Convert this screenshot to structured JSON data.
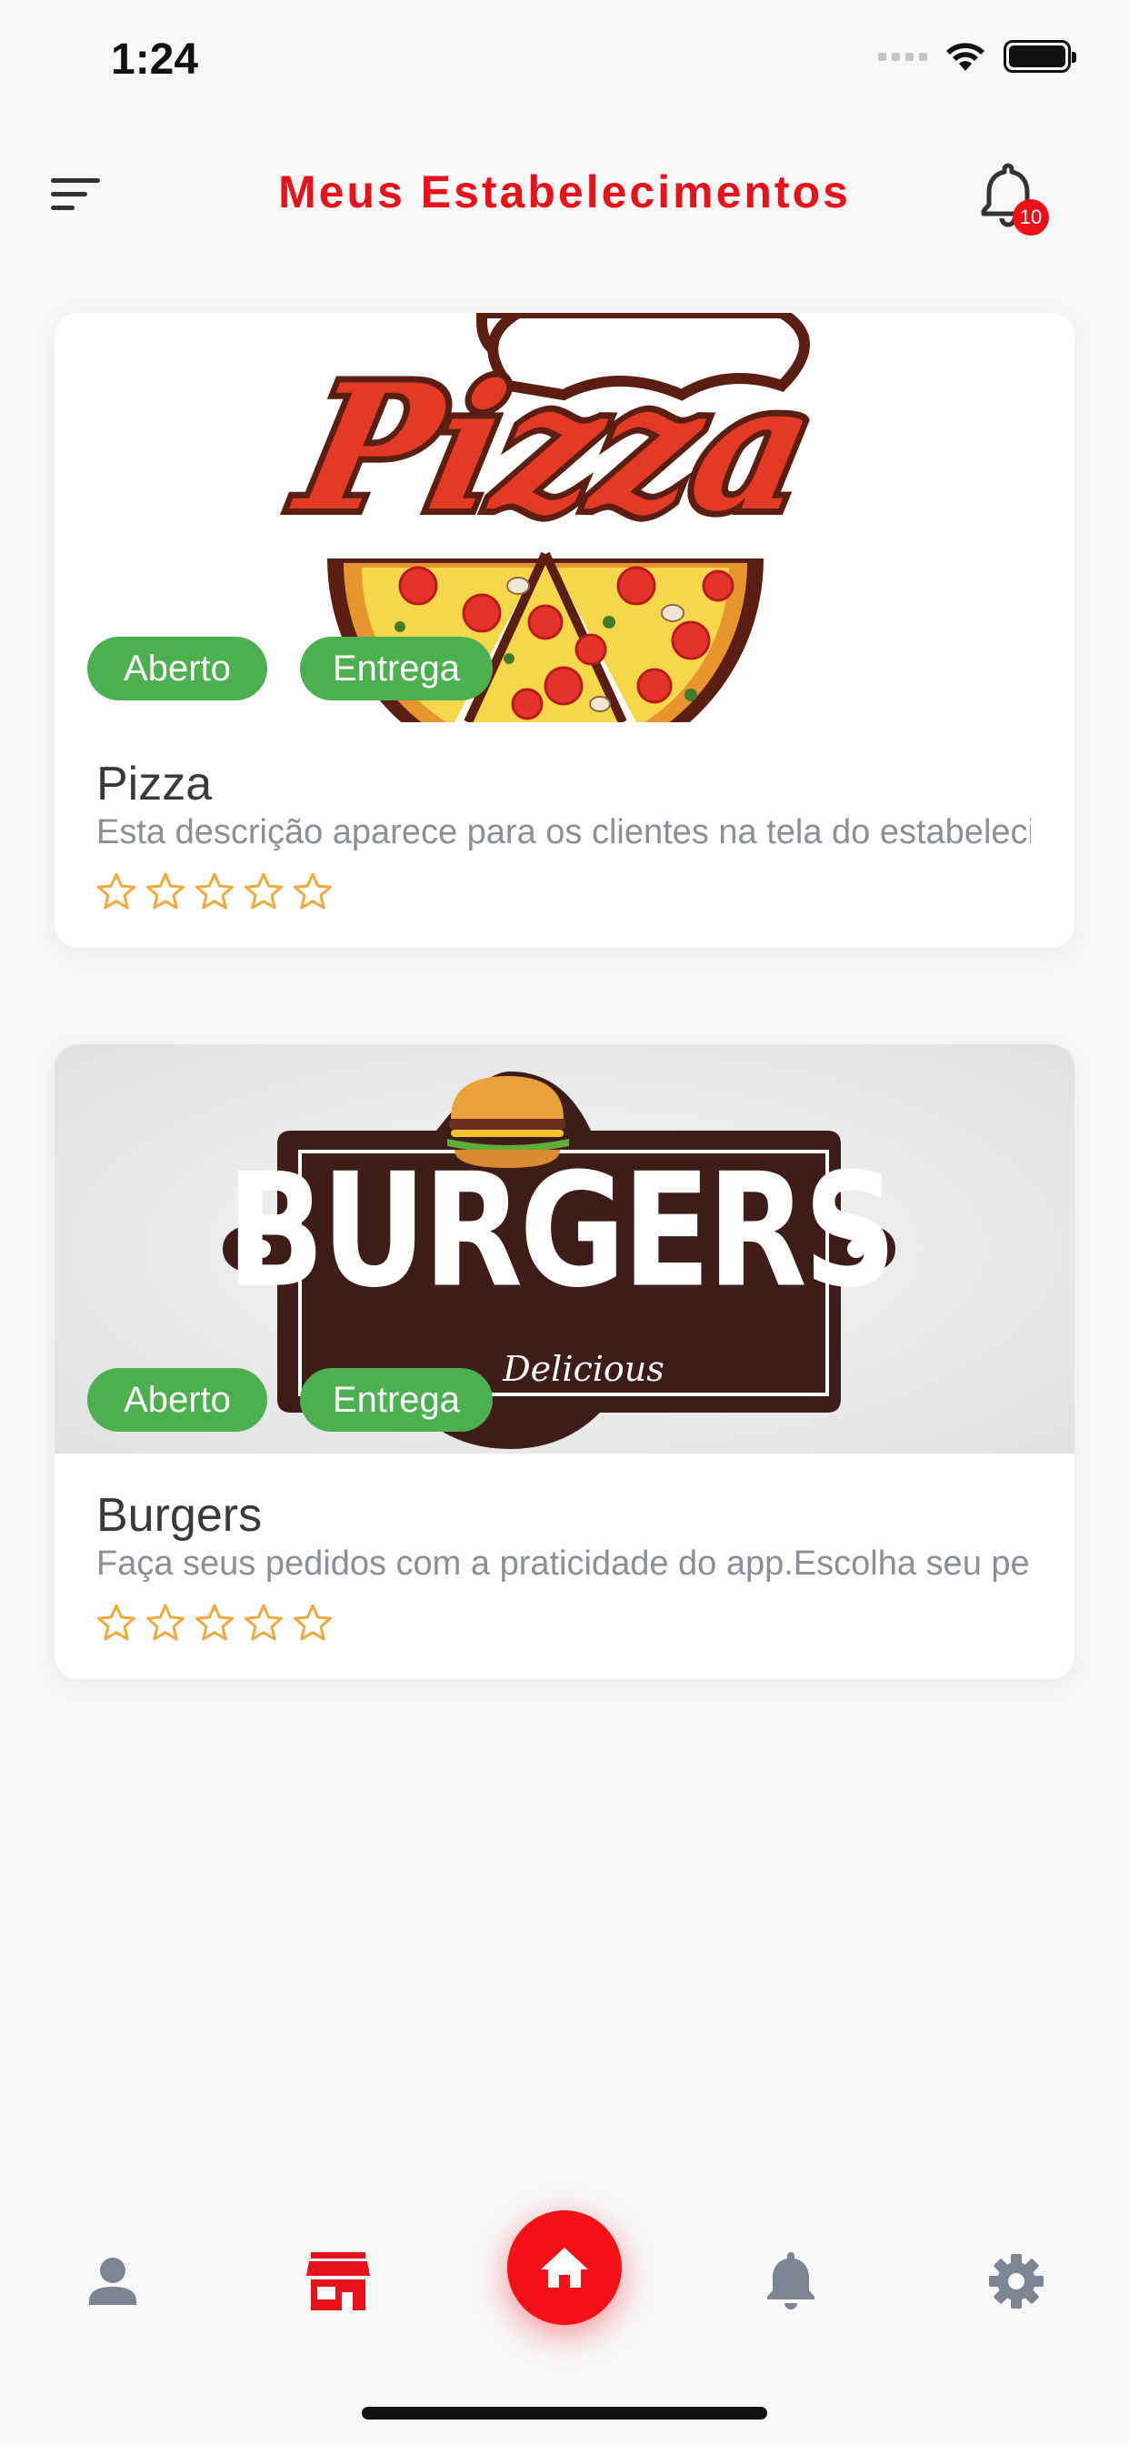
{
  "status_bar": {
    "time": "1:24"
  },
  "header": {
    "title": "Meus Estabelecimentos",
    "notification_count": "10"
  },
  "establishments": [
    {
      "name": "Pizza",
      "description": "Esta descrição aparece para os clientes na tela do estabelecimento",
      "tags": [
        "Aberto",
        "Entrega"
      ],
      "rating": 0,
      "max_rating": 5,
      "logo_text": "Pizza"
    },
    {
      "name": "Burgers",
      "description": "Faça seus pedidos com a praticidade do app.Escolha seu pedido",
      "tags": [
        "Aberto",
        "Entrega"
      ],
      "rating": 0,
      "max_rating": 5,
      "logo_text": "BURGERS",
      "logo_subtext": "Delicious"
    }
  ],
  "bottom_nav": {
    "items": [
      {
        "icon": "person-icon",
        "active": false
      },
      {
        "icon": "store-icon",
        "active": true
      },
      {
        "icon": "home-icon",
        "active": false
      },
      {
        "icon": "bell-icon",
        "active": false
      },
      {
        "icon": "gear-icon",
        "active": false
      }
    ]
  },
  "colors": {
    "primary": "#e8121c",
    "tag_green": "#4caf50",
    "star": "#f2a83b",
    "nav_inactive": "#7c8593",
    "background": "#f8f8f9"
  }
}
